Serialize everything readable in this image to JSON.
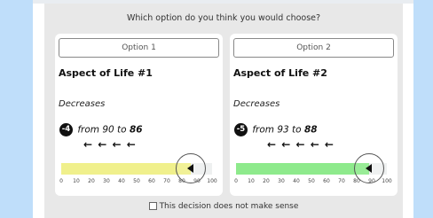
{
  "question": "Which option do you think you would choose?",
  "options": [
    {
      "button_label": "Option 1",
      "aspect": "Aspect of Life #1",
      "direction": "Decreases",
      "change": "-4",
      "from_text": "from 90 to",
      "to_value": "86",
      "arrows": "← ← ← ←",
      "slider_value": 86,
      "fill_color": "#f0f08c"
    },
    {
      "button_label": "Option 2",
      "aspect": "Aspect of Life #2",
      "direction": "Decreases",
      "change": "-5",
      "from_text": "from 93 to",
      "to_value": "88",
      "arrows": "← ← ← ← ←",
      "slider_value": 88,
      "fill_color": "#8eea8c"
    }
  ],
  "scale_ticks": [
    "0",
    "10",
    "20",
    "30",
    "40",
    "50",
    "60",
    "70",
    "80",
    "90",
    "100"
  ],
  "scale_max": 100,
  "footer_checkbox_label": "This decision does not make sense",
  "colors": {
    "side_panels": "#bfdefa",
    "background": "#e8e8e8",
    "frame": "#222222"
  }
}
